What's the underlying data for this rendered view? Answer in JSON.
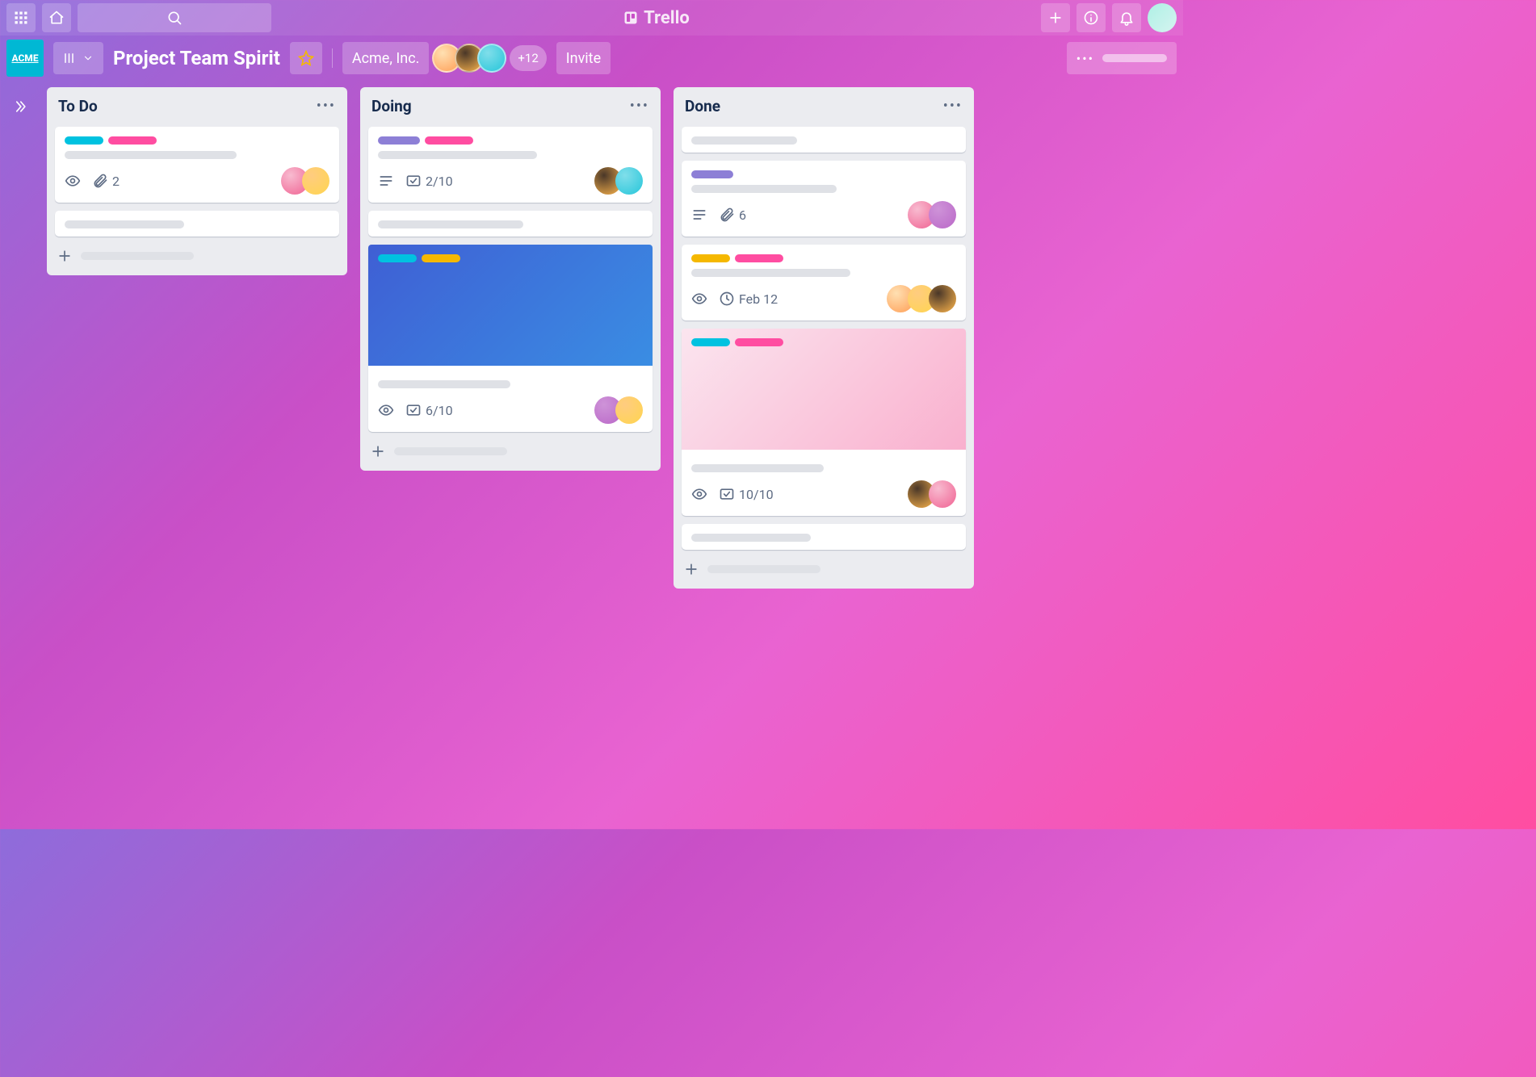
{
  "brand": "Trello",
  "workspace_logo": "ACME",
  "board": {
    "title": "Project Team Spirit",
    "team": "Acme, Inc.",
    "extra_members": "+12",
    "invite": "Invite"
  },
  "lists": [
    {
      "title": "To Do",
      "cards": [
        {
          "labels": [
            "cyan",
            "pink"
          ],
          "badges": {
            "attachments": "2"
          },
          "members": [
            "av6",
            "av4"
          ]
        },
        {
          "placeholder": true
        }
      ]
    },
    {
      "title": "Doing",
      "cards": [
        {
          "labels": [
            "purple",
            "pink"
          ],
          "badges": {
            "checklist": "2/10"
          },
          "members": [
            "av2",
            "av3"
          ]
        },
        {
          "placeholder": true
        },
        {
          "cover": "blue",
          "labels": [
            "cyan",
            "yellow"
          ],
          "badges": {
            "checklist": "6/10"
          },
          "members": [
            "av5",
            "av4"
          ]
        }
      ]
    },
    {
      "title": "Done",
      "cards": [
        {
          "placeholder": true
        },
        {
          "labels": [
            "purple"
          ],
          "badges": {
            "attachments": "6"
          },
          "members": [
            "av6",
            "av5"
          ]
        },
        {
          "labels": [
            "yellow",
            "pink"
          ],
          "badges": {
            "due": "Feb 12"
          },
          "members": [
            "av1",
            "av4",
            "av2"
          ]
        },
        {
          "cover": "pink",
          "labels": [
            "cyan",
            "pink"
          ],
          "badges": {
            "checklist": "10/10"
          },
          "members": [
            "av2",
            "av6"
          ]
        },
        {
          "placeholder": true
        }
      ]
    }
  ]
}
